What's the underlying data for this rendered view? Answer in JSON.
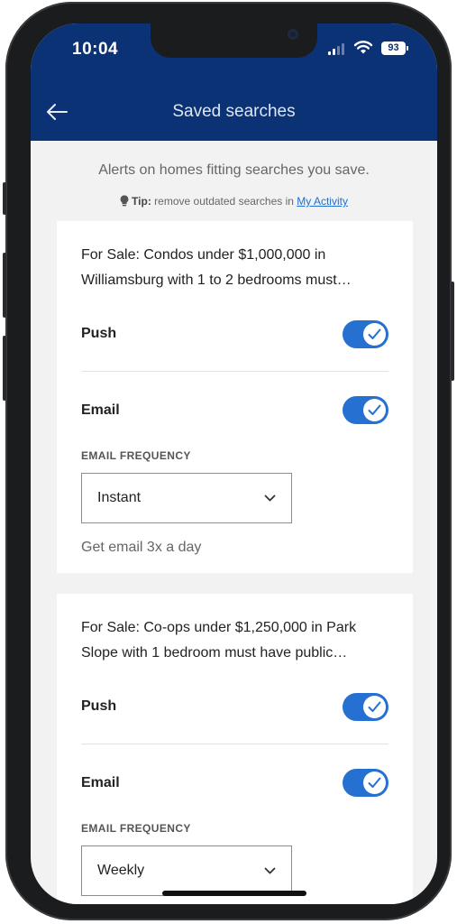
{
  "status_bar": {
    "time": "10:04",
    "battery": "93"
  },
  "header": {
    "title": "Saved searches"
  },
  "intro": {
    "text": "Alerts on homes fitting searches you save.",
    "tip_label": "Tip:",
    "tip_text": "remove outdated searches in",
    "tip_link": "My Activity"
  },
  "searches": [
    {
      "description": "For Sale: Condos under $1,000,000 in Williamsburg with 1 to 2 bedrooms must…",
      "push_label": "Push",
      "push_enabled": true,
      "email_label": "Email",
      "email_enabled": true,
      "frequency_label": "EMAIL FREQUENCY",
      "frequency_value": "Instant",
      "helper": "Get email 3x a day"
    },
    {
      "description": "For Sale: Co-ops under $1,250,000 in Park Slope with 1 bedroom must have public…",
      "push_label": "Push",
      "push_enabled": true,
      "email_label": "Email",
      "email_enabled": true,
      "frequency_label": "EMAIL FREQUENCY",
      "frequency_value": "Weekly"
    }
  ],
  "colors": {
    "brand_navy": "#0b3275",
    "toggle_on": "#2570d0",
    "link": "#1c6fd6"
  },
  "icons": [
    "back-arrow-icon",
    "lightbulb-icon",
    "check-icon",
    "chevron-down-icon",
    "wifi-icon",
    "signal-icon",
    "battery-icon"
  ]
}
